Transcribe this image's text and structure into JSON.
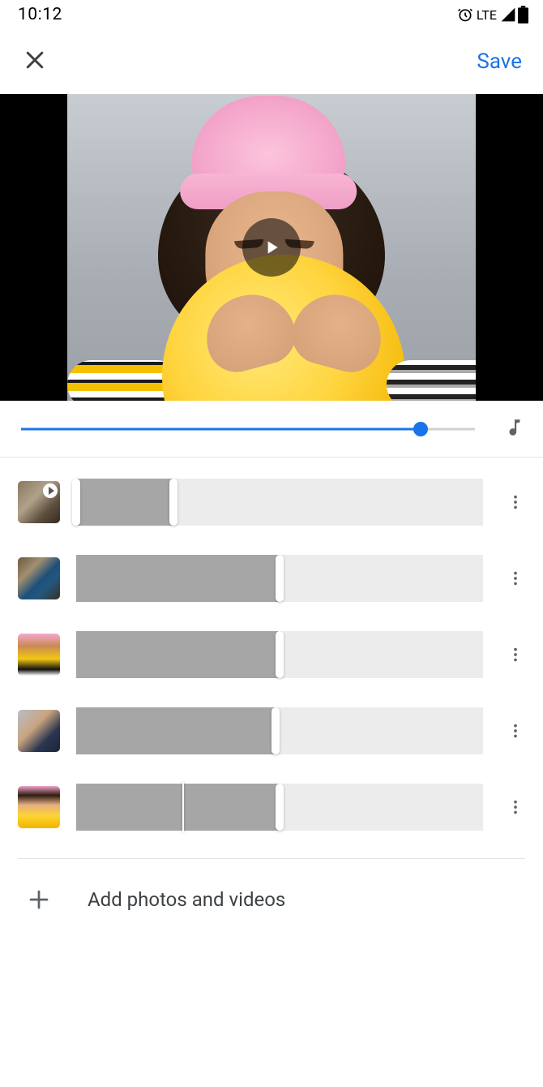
{
  "status_bar": {
    "time": "10:12",
    "network": "LTE"
  },
  "header": {
    "save_label": "Save"
  },
  "playback": {
    "progress_pct": 88
  },
  "clips": [
    {
      "is_video": true,
      "thumb_class": "th1",
      "trim_left_pct": 0,
      "trim_right_pct": 24,
      "playhead_pct": null
    },
    {
      "is_video": false,
      "thumb_class": "th2",
      "trim_left_pct": 0,
      "trim_right_pct": 50,
      "playhead_pct": null
    },
    {
      "is_video": false,
      "thumb_class": "th3",
      "trim_left_pct": 0,
      "trim_right_pct": 50,
      "playhead_pct": null
    },
    {
      "is_video": false,
      "thumb_class": "th4",
      "trim_left_pct": 0,
      "trim_right_pct": 49,
      "playhead_pct": null
    },
    {
      "is_video": false,
      "thumb_class": "th5",
      "trim_left_pct": 0,
      "trim_right_pct": 50,
      "playhead_pct": 26
    }
  ],
  "add_row": {
    "label": "Add photos and videos"
  }
}
